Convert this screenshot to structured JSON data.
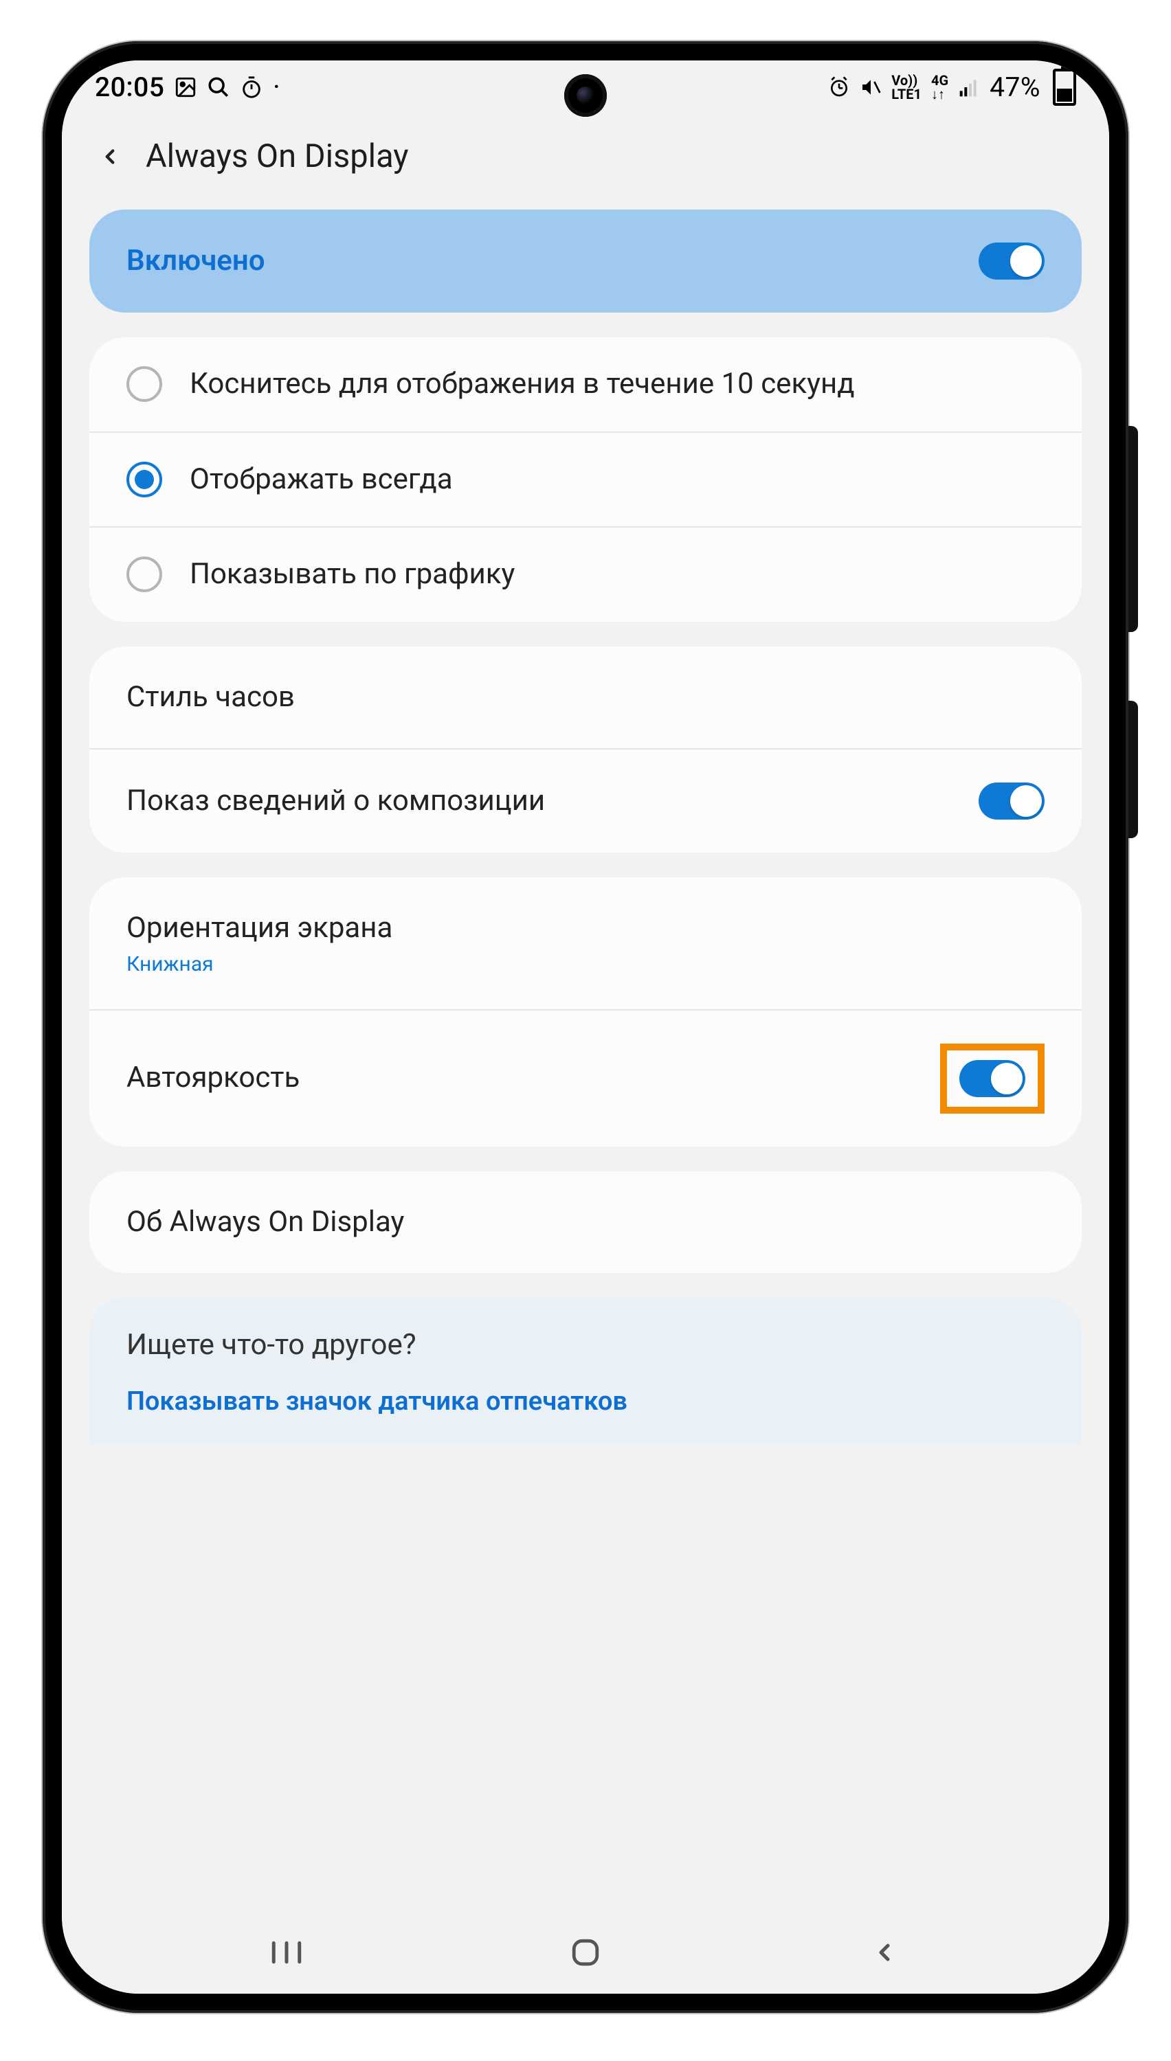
{
  "status": {
    "time": "20:05",
    "battery_text": "47%"
  },
  "header": {
    "title": "Always On Display"
  },
  "enabled_card": {
    "label": "Включено",
    "on": true
  },
  "display_mode": {
    "options": [
      {
        "label": "Коснитесь для отображения в течение 10 секунд",
        "selected": false
      },
      {
        "label": "Отображать всегда",
        "selected": true
      },
      {
        "label": "Показывать по графику",
        "selected": false
      }
    ]
  },
  "clock_section": {
    "clock_style": "Стиль часов",
    "music_info": "Показ сведений о композиции",
    "music_info_on": true
  },
  "screen_section": {
    "orientation_label": "Ориентация экрана",
    "orientation_value": "Книжная",
    "auto_brightness": "Автояркость",
    "auto_brightness_on": true
  },
  "about": {
    "label": "Об Always On Display"
  },
  "hint": {
    "title": "Ищете что-то другое?",
    "link": "Показывать значок датчика отпечатков"
  }
}
